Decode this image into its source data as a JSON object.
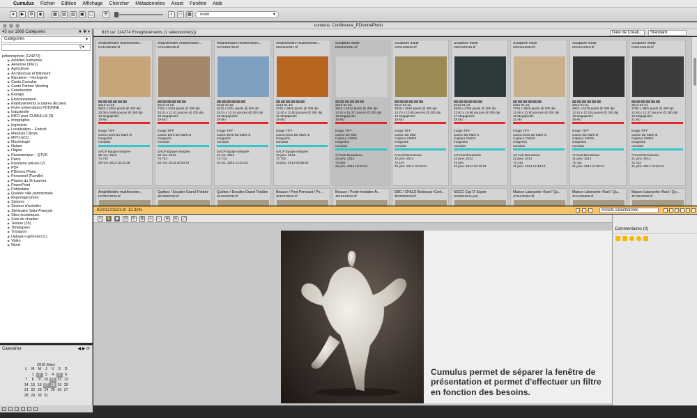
{
  "menubar": {
    "apple": "",
    "items": [
      "Cumulus",
      "Fichier",
      "Edition",
      "Affichage",
      "Chercher",
      "Métadonnées",
      "Asset",
      "Fenêtre",
      "Aide"
    ]
  },
  "toolbar": {
    "search_value": "oooo"
  },
  "window": {
    "title": "cumulus: Conférence_PDionnePhoto"
  },
  "sidebar": {
    "count_text": "45 sur 1968 Catégories",
    "dropdown": "Catégories",
    "tree": [
      {
        "label": "pdionnephoto (124274)",
        "type": "root"
      },
      {
        "label": "Activités humaines",
        "type": "node"
      },
      {
        "label": "Aérienne (9661)",
        "type": "node"
      },
      {
        "label": "Agriculture",
        "type": "node"
      },
      {
        "label": "Architecture et Bâtiment",
        "type": "node"
      },
      {
        "label": "Bijouterie – Horlogerie",
        "type": "node"
      },
      {
        "label": "Canto Cumulus",
        "type": "node"
      },
      {
        "label": "Canto Partner Meeting",
        "type": "node"
      },
      {
        "label": "Construction",
        "type": "node"
      },
      {
        "label": "Énergie",
        "type": "node"
      },
      {
        "label": "Environnement",
        "type": "node"
      },
      {
        "label": "Établissements scolaires (Écoles)",
        "type": "node"
      },
      {
        "label": "Fiche présentation PDIONNE",
        "type": "node"
      },
      {
        "label": "Industrielle",
        "type": "node"
      },
      {
        "label": "INFO pour CUMULUS (3)",
        "type": "node"
      },
      {
        "label": "Infographie",
        "type": "node"
      },
      {
        "label": "Ingénierie",
        "type": "node"
      },
      {
        "label": "Localisation – Endroit",
        "type": "node"
      },
      {
        "label": "Mandats Clients",
        "type": "node"
      },
      {
        "label": "MPO-GCC",
        "type": "node"
      },
      {
        "label": "Muséologie",
        "type": "node"
      },
      {
        "label": "Nature",
        "type": "node"
      },
      {
        "label": "Objets",
        "type": "node"
      },
      {
        "label": "Panoramique – QTVR",
        "type": "node"
      },
      {
        "label": "Parcs",
        "type": "node"
      },
      {
        "label": "Parutions articles (2)",
        "type": "node"
      },
      {
        "label": "PDF",
        "type": "node"
      },
      {
        "label": "PDionne Photo",
        "type": "node"
      },
      {
        "label": "Personnel (Famille)",
        "type": "node"
      },
      {
        "label": "Phares du St-Laurent",
        "type": "node"
      },
      {
        "label": "PowerPoint",
        "type": "node"
      },
      {
        "label": "Publicitaire",
        "type": "node"
      },
      {
        "label": "Québec ville patrimoniale",
        "type": "node i"
      },
      {
        "label": "Reportage photo",
        "type": "node"
      },
      {
        "label": "Saisons",
        "type": "node"
      },
      {
        "label": "Secteur d'activités",
        "type": "node"
      },
      {
        "label": "Séminaire Saint-François",
        "type": "node i"
      },
      {
        "label": "Sites touristiques",
        "type": "node"
      },
      {
        "label": "Suivi de chantier",
        "type": "node"
      },
      {
        "label": "Texture (35)",
        "type": "node"
      },
      {
        "label": "Timelapses",
        "type": "node"
      },
      {
        "label": "Transport",
        "type": "node"
      },
      {
        "label": "Upload--Lightroom (1)",
        "type": "node"
      },
      {
        "label": "Vidéo",
        "type": "node"
      },
      {
        "label": "Word",
        "type": "node"
      }
    ]
  },
  "calendar": {
    "label": "Calendrier",
    "month": "2016 Mars",
    "weekdays": [
      "L",
      "M",
      "M",
      "J",
      "V",
      "S",
      "D"
    ],
    "days": [
      {
        "d": "",
        "s": 0
      },
      {
        "d": "1",
        "s": 0
      },
      {
        "d": "2",
        "s": 1
      },
      {
        "d": "3",
        "s": 0
      },
      {
        "d": "4",
        "s": 0
      },
      {
        "d": "5",
        "s": 1
      },
      {
        "d": "6",
        "s": 0
      },
      {
        "d": "7",
        "s": 0
      },
      {
        "d": "8",
        "s": 0
      },
      {
        "d": "9",
        "s": 0
      },
      {
        "d": "10",
        "s": 0
      },
      {
        "d": "11",
        "s": 1
      },
      {
        "d": "12",
        "s": 0
      },
      {
        "d": "13",
        "s": 0
      },
      {
        "d": "14",
        "s": 0
      },
      {
        "d": "15",
        "s": 0
      },
      {
        "d": "16",
        "s": 0
      },
      {
        "d": "17",
        "s": 1
      },
      {
        "d": "18",
        "s": 1
      },
      {
        "d": "19",
        "s": 0
      },
      {
        "d": "20",
        "s": 0
      },
      {
        "d": "21",
        "s": 0
      },
      {
        "d": "22",
        "s": 0
      },
      {
        "d": "23",
        "s": 0
      },
      {
        "d": "24",
        "s": 0
      },
      {
        "d": "25",
        "s": 0
      },
      {
        "d": "26",
        "s": 0
      },
      {
        "d": "27",
        "s": 0
      },
      {
        "d": "28",
        "s": 0
      },
      {
        "d": "29",
        "s": 0
      },
      {
        "d": "30",
        "s": 0
      },
      {
        "d": "31",
        "s": 0
      },
      {
        "d": "",
        "s": 0
      },
      {
        "d": "",
        "s": 0
      },
      {
        "d": "",
        "s": 0
      }
    ]
  },
  "grid": {
    "count_text": "815 sur 124274 Enregistrements (1 sélectionné(s))",
    "sort": "Date de Créati...",
    "view": "Standard",
    "cards": [
      {
        "title": "Amphithéâtre multifonction...",
        "file": "KC11280195.tif",
        "date": "2013-11-28",
        "dims": "6924 x 2064 pixels @ 300 dpi",
        "size": "23.08 x 9.68 pouces @ 300 dpi",
        "mp": "16 Megapixels",
        "mb": "19 Mo",
        "type": "Image TIFF",
        "cam": "Canon EOS 5D Mark III",
        "cap": "",
        "img": "",
        "kw": "Images01",
        "ex": "nomalas",
        "copy": "SACP Équipe Intégrée",
        "d2": "28 nov. 2013",
        "n": "74 742",
        "d3": "28 nov. 2013 18:12:48",
        "color": "#c8a47a"
      },
      {
        "title": "Amphithéâtre multifonction...",
        "file": "KC11280195.tif",
        "date": "2013-11-28",
        "dims": "7283 x 2424 pixels @ 300 dpi",
        "size": "24.31 x 11.41 pouces @ 300 dpi",
        "mp": "23 Megapixels",
        "mb": "19 Mo",
        "type": "Image TIFF",
        "cam": "Canon EOS 5D Mark III",
        "cap": "",
        "img": "",
        "kw": "Images01",
        "ex": "nomalas",
        "copy": "SACP Équipe Intégrée",
        "d2": "28 nov. 2013",
        "n": "74 742",
        "d3": "28 nov. 2013 20:03:43",
        "color": "#a3876a"
      },
      {
        "title": "Amphithéâtre multifonction...",
        "file": "KC10180703.tif",
        "date": "2013-10-18",
        "dims": "5312 x 3751 pixels @ 300 dpi",
        "size": "18.51 x 12.34 pouces @ 300 dpi",
        "mp": "19 Megapixels",
        "mb": "29 Mo",
        "type": "Image TIFF",
        "cam": "Canon EOS 5D Mark III",
        "cap": "",
        "img": "",
        "kw": "Images01",
        "ex": "nomalas",
        "copy": "SACP Équipe Intégrée",
        "d2": "10 oct. 2013",
        "n": "74 712",
        "d3": "10 oct. 2013 14:31:03",
        "color": "#7d9fc0"
      },
      {
        "title": "Amphithéâtre multifonction...",
        "file": "KD01140317.tif",
        "date": "2014-01-10",
        "dims": "3740 x 3840 pixels @ 300 dpi",
        "size": "12.40 x 12.80 pouces @ 300 dpi",
        "mp": "21 Megapixels",
        "mb": "29 Mo",
        "type": "Image TIFF",
        "cam": "Canon EOS 5D Mark III",
        "cap": "",
        "img": "",
        "kw": "Images01",
        "ex": "nomalas",
        "copy": "SACP Équipe Intégrée",
        "d2": "10 janv. 2014",
        "n": "72 752",
        "d3": "10 janv. 2014 09:38:28",
        "color": "#b8651f"
      },
      {
        "title": "Sculpture Inuite",
        "file": "KD01221321.tif",
        "date": "2014-01-22",
        "dims": "3843 x 4612 pixels @ 300 dpi",
        "size": "12.81 x 15.37 pouces @ 300 dpi",
        "mp": "18 Megapixels",
        "mb": "19 Mo",
        "type": "Image TIFF",
        "cam": "Canon 5D MkII",
        "cap": "Capteur CMOS",
        "img": "Images01",
        "kw": "nomalas",
        "ex": "",
        "copy": "Art Inuit Brousseau",
        "d2": "22 janv. 2014",
        "n": "72 669",
        "d3": "22 janv. 2014 10:15:21",
        "color": "#cfcfcf"
      },
      {
        "title": "Sculpture Inuite",
        "file": "KD01220616.tif",
        "date": "2014-01-22",
        "dims": "3829 x 3840 pixels @ 300 dpi",
        "size": "12.76 x 12.80 pouces @ 300 dpi",
        "mp": "14 Megapixels",
        "mb": "18 Mo",
        "type": "Image TIFF",
        "cam": "Canon 5D MkII",
        "cap": "Capteur CMOS",
        "img": "Images01",
        "kw": "nomalas",
        "ex": "",
        "copy": "Art Inuit Brousseau",
        "d2": "22 janv. 2014",
        "n": "72 107",
        "d3": "22 janv. 2014 10:23:21",
        "color": "#9c8a55"
      },
      {
        "title": "Sculpture Inuite",
        "file": "KD01220116.tif",
        "date": "2014-01-22",
        "dims": "3843 x 4788 pixels @ 300 dpi",
        "size": "12.81 x 15.96 pouces @ 300 dpi",
        "mp": "17 Megapixels",
        "mb": "28 Mo",
        "type": "Image TIFF",
        "cam": "Canon 5D Mark II",
        "cap": "Capteur CMOS",
        "img": "Images01",
        "kw": "nomalas",
        "ex": "",
        "copy": "Art Inuit Brousseau",
        "d2": "22 janv. 2014",
        "n": "72 694",
        "d3": "22 janv. 2014 10:13:23",
        "color": "#2e3a3a"
      },
      {
        "title": "Sculpture Inuite",
        "file": "KD01210822.tif",
        "date": "2014-01-21",
        "dims": "3765 x 3840 pixels @ 300 dpi",
        "size": "12.55 x 12.80 pouces @ 300 dpi",
        "mp": "18 Megapixels",
        "mb": "21 Mo",
        "type": "Image TIFF",
        "cam": "Canon EOS 5D Mark III",
        "cap": "Capteur CMOS",
        "img": "Images01",
        "kw": "nomalas",
        "ex": "",
        "copy": "Art Inuit Brousseau",
        "d2": "21 janv. 2014",
        "n": "72 413",
        "d3": "21 janv. 2014 14:48:10",
        "color": "#c8b08a"
      },
      {
        "title": "Sculpture Inuite",
        "file": "KD01210119.tif",
        "date": "2014-01-21",
        "dims": "3843 x 5176 pixels @ 300 dpi",
        "size": "12.81 x 17.25 pouces @ 300 dpi",
        "mp": "19 Megapixels",
        "mb": "28 Mo",
        "type": "Image TIFF",
        "cam": "Canon 5D Mark III",
        "cap": "Capteur CMOS",
        "img": "Images01",
        "kw": "nomalas",
        "ex": "",
        "copy": "Art Inuit Brousseau",
        "d2": "21 janv. 2014",
        "n": "72 411",
        "d3": "21 janv. 2014 11:00:44",
        "color": "#333333"
      },
      {
        "title": "Sculpture Inuite",
        "file": "KD01210105.tif",
        "date": "2014-01-21",
        "dims": "3790 x 3681 pixels @ 300 dpi",
        "size": "12.63 x 12.27 pouces @ 300 dpi",
        "mp": "14 Megapixels",
        "mb": "21 Mo",
        "type": "Image TIFF",
        "cam": "Canon 5D Mark III",
        "cap": "Capteur CMOS",
        "img": "Images01",
        "kw": "nomalas",
        "ex": "",
        "copy": "Art Inuit Brousseau",
        "d2": "21 janv. 2014",
        "n": "72 411",
        "d3": "21 janv. 2014 10:54:24",
        "color": "#3d3d3d"
      }
    ],
    "row2": [
      {
        "title": "Amphithéâtre multifonction...",
        "file": "KC09270226.tif"
      },
      {
        "title": "Québec / Escalier Grand Théâtre",
        "file": "JE10280234.tif"
      },
      {
        "title": "Québec / Escalier Grand Théâtre",
        "file": "JE10280234.tif"
      },
      {
        "title": "Beauce / Pont Perreault / Po...",
        "file": "JE10210510.tif"
      },
      {
        "title": "Beauce / Poste frontalier Ar...",
        "file": "JE10210015.tif"
      },
      {
        "title": "EBC / CHSLD Bodreaux–Carti...",
        "file": "JE09090513.tif"
      },
      {
        "title": "NGCC Cap D' Espoir",
        "file": "JE08310214.psd"
      },
      {
        "title": "Maison Lalancette–Ruel / Qu...",
        "file": "JF11240454.tif"
      },
      {
        "title": "Maison Lalancette–Ruel / Qu...",
        "file": "JF11240408.tif"
      },
      {
        "title": "Maison Lalancette–Ruel / Qu...",
        "file": "JF11240530.tif"
      }
    ]
  },
  "preview": {
    "filename": "KD01221321.tif",
    "zoom": "12.32%",
    "assets_dropdown": "Assets sélectionnés",
    "caption": "Cumulus permet de séparer la fenêtre de présentation et permet d'effectuer un filtre en fonction des besoins."
  },
  "comments": {
    "title": "Commentaires (0)"
  }
}
